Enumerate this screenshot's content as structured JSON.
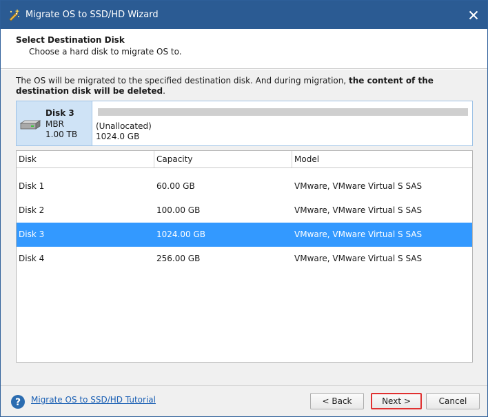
{
  "window": {
    "title": "Migrate OS to SSD/HD Wizard",
    "icons": {
      "app": "wizard-app-icon",
      "close": "close-icon"
    },
    "colors": {
      "titlebar": "#2b5b93",
      "selection": "#3399ff",
      "link": "#1a5fb4",
      "highlight_border": "#e03030"
    }
  },
  "header": {
    "title": "Select Destination Disk",
    "subtitle": "Choose a hard disk to migrate OS to."
  },
  "warning": {
    "text_normal": "The OS will be migrated to the specified destination disk. And during migration, ",
    "text_bold": "the content of the destination disk will be deleted",
    "text_end": "."
  },
  "selected_disk": {
    "name": "Disk 3",
    "type": "MBR",
    "size": "1.00 TB",
    "partition_label": "(Unallocated)",
    "partition_size": "1024.0 GB",
    "icon": "hard-disk-icon"
  },
  "table": {
    "columns": {
      "disk": "Disk",
      "capacity": "Capacity",
      "model": "Model"
    },
    "rows": [
      {
        "disk": "Disk 1",
        "capacity": "60.00 GB",
        "model": "VMware, VMware Virtual S SAS"
      },
      {
        "disk": "Disk 2",
        "capacity": "100.00 GB",
        "model": "VMware, VMware Virtual S SAS"
      },
      {
        "disk": "Disk 3",
        "capacity": "1024.00 GB",
        "model": "VMware, VMware Virtual S SAS"
      },
      {
        "disk": "Disk 4",
        "capacity": "256.00 GB",
        "model": "VMware, VMware Virtual S SAS"
      }
    ],
    "selected_index": 2
  },
  "footer": {
    "tutorial_link": "Migrate OS to SSD/HD Tutorial",
    "help_icon": "help-icon",
    "back_label": "< Back",
    "next_label": "Next >",
    "cancel_label": "Cancel"
  }
}
